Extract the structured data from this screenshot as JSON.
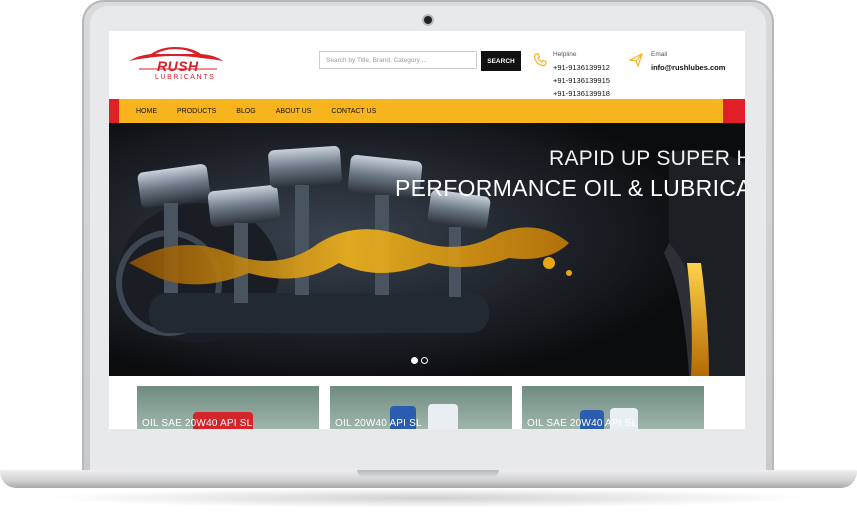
{
  "brand": {
    "name": "RUSH",
    "tagline": "LUBRICANTS",
    "primary_color": "#e11f26",
    "accent_color": "#f7b41d"
  },
  "search": {
    "placeholder": "Search by Title, Brand, Category ...",
    "button_label": "SEARCH"
  },
  "helpline": {
    "label": "Helpline",
    "phones": [
      "+91-9136139912",
      "+91-9136139915",
      "+91-9136139918"
    ],
    "icon": "phone-icon"
  },
  "email": {
    "label": "Email",
    "value": "info@rushlubes.com",
    "icon": "paper-plane-icon"
  },
  "nav": {
    "items": [
      "HOME",
      "PRODUCTS",
      "BLOG",
      "ABOUT US",
      "CONTACT US"
    ]
  },
  "hero": {
    "line1": "RAPID UP SUPER H",
    "line2": "PERFORMANCE OIL & LUBRICA",
    "slide_count": 2,
    "active_slide": 1
  },
  "products": [
    {
      "title": "OIL SAE 20W40 API SL"
    },
    {
      "title": "OIL 20W40 API SL"
    },
    {
      "title": "OIL SAE 20W40 API SL"
    }
  ]
}
